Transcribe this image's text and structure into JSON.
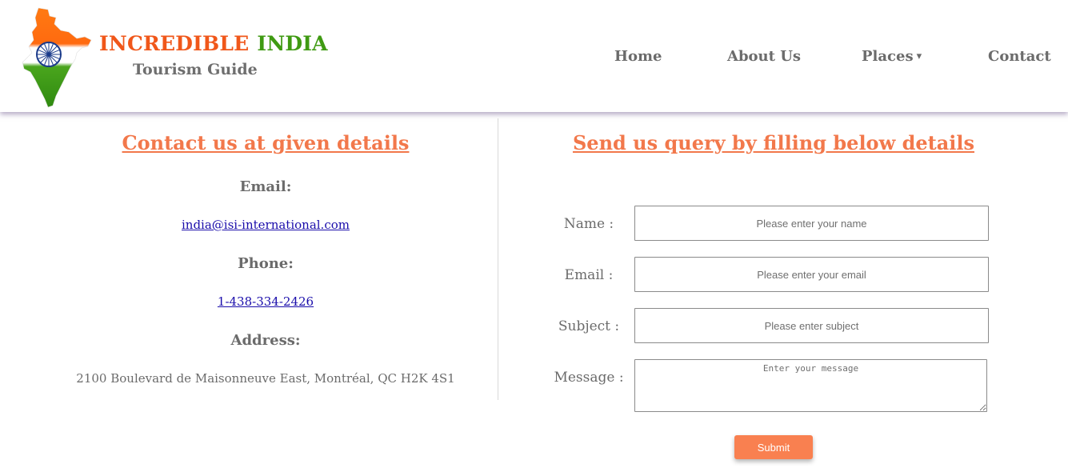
{
  "brand": {
    "title_word1": "INCREDIBLE",
    "title_word2": "INDIA",
    "subtitle": "Tourism Guide",
    "logo_icon": "india-map-flag-icon",
    "colors": {
      "saffron": "#f0571a",
      "green": "#3f9a12"
    }
  },
  "nav": {
    "items": [
      {
        "label": "Home"
      },
      {
        "label": "About Us"
      },
      {
        "label": "Places",
        "dropdown_icon": "caret-down-icon"
      },
      {
        "label": "Contact"
      }
    ],
    "caret": "▾"
  },
  "contact": {
    "heading": "Contact us at given details",
    "email_label": "Email:",
    "email_value": "india@isi-international.com",
    "phone_label": "Phone:",
    "phone_value": "1-438-334-2426",
    "address_label": "Address:",
    "address_value": "2100 Boulevard de Maisonneuve East, Montréal, QC H2K 4S1"
  },
  "form": {
    "heading": "Send us query by filling below details",
    "name_label": "Name :",
    "name_placeholder": "Please enter your name",
    "email_label": "Email :",
    "email_placeholder": "Please enter your email",
    "subject_label": "Subject :",
    "subject_placeholder": "Please enter subject",
    "message_label": "Message :",
    "message_placeholder": "Enter your message",
    "submit_label": "Submit"
  },
  "colors": {
    "accent": "#f2784b",
    "button": "#f98050",
    "text_gray": "#6b6b6b",
    "link": "#1a0dab"
  }
}
